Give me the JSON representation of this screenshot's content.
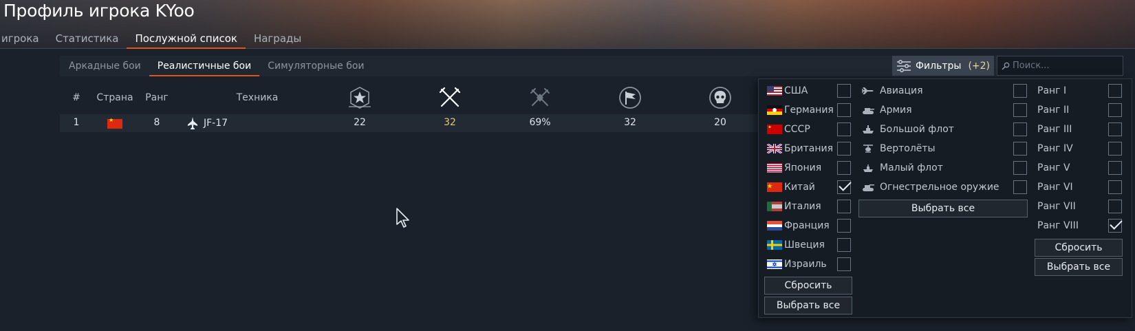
{
  "page": {
    "title": "Профиль игрока KYoo",
    "tabs": [
      "игрока",
      "Статистика",
      "Послужной список",
      "Награды"
    ],
    "active_tab": "Послужной список"
  },
  "battle_tabs": {
    "items": [
      "Аркадные бои",
      "Реалистичные бои",
      "Симуляторные бои"
    ],
    "active": "Реалистичные бои"
  },
  "toolbar": {
    "filters_label": "Фильтры",
    "filters_count": "(+2)",
    "search_placeholder": "Поиск..."
  },
  "table": {
    "headers": [
      "#",
      "Страна",
      "Ранг",
      "Техника"
    ],
    "stat_icons": [
      "battles-icon",
      "victories-crossed-swords-icon",
      "win-rate-icon",
      "flag-capture-icon",
      "skull-kills-icon"
    ],
    "rows": [
      {
        "num": "1",
        "country": "Китай",
        "rank": "8",
        "vehicle": "JF-17",
        "stats": [
          "22",
          "32",
          "69%",
          "32",
          "20"
        ]
      }
    ]
  },
  "filter_panel": {
    "nations": [
      {
        "label": "США",
        "checked": false
      },
      {
        "label": "Германия",
        "checked": false
      },
      {
        "label": "СССР",
        "checked": false
      },
      {
        "label": "Британия",
        "checked": false
      },
      {
        "label": "Япония",
        "checked": false
      },
      {
        "label": "Китай",
        "checked": true
      },
      {
        "label": "Италия",
        "checked": false
      },
      {
        "label": "Франция",
        "checked": false
      },
      {
        "label": "Швеция",
        "checked": false
      },
      {
        "label": "Израиль",
        "checked": false
      }
    ],
    "types": [
      {
        "label": "Авиация",
        "icon": "airplane-icon",
        "checked": false
      },
      {
        "label": "Армия",
        "icon": "tank-icon",
        "checked": false
      },
      {
        "label": "Большой флот",
        "icon": "large-ship-icon",
        "checked": false
      },
      {
        "label": "Вертолёты",
        "icon": "helicopter-icon",
        "checked": false
      },
      {
        "label": "Малый флот",
        "icon": "small-boat-icon",
        "checked": false
      },
      {
        "label": "Огнестрельное оружие",
        "icon": "firearm-icon",
        "checked": false
      }
    ],
    "ranks": [
      {
        "label": "Ранг I",
        "checked": false
      },
      {
        "label": "Ранг II",
        "checked": false
      },
      {
        "label": "Ранг III",
        "checked": false
      },
      {
        "label": "Ранг IV",
        "checked": false
      },
      {
        "label": "Ранг V",
        "checked": false
      },
      {
        "label": "Ранг VI",
        "checked": false
      },
      {
        "label": "Ранг VII",
        "checked": false
      },
      {
        "label": "Ранг VIII",
        "checked": true
      }
    ],
    "reset_label": "Сбросить",
    "select_all_label": "Выбрать все"
  }
}
